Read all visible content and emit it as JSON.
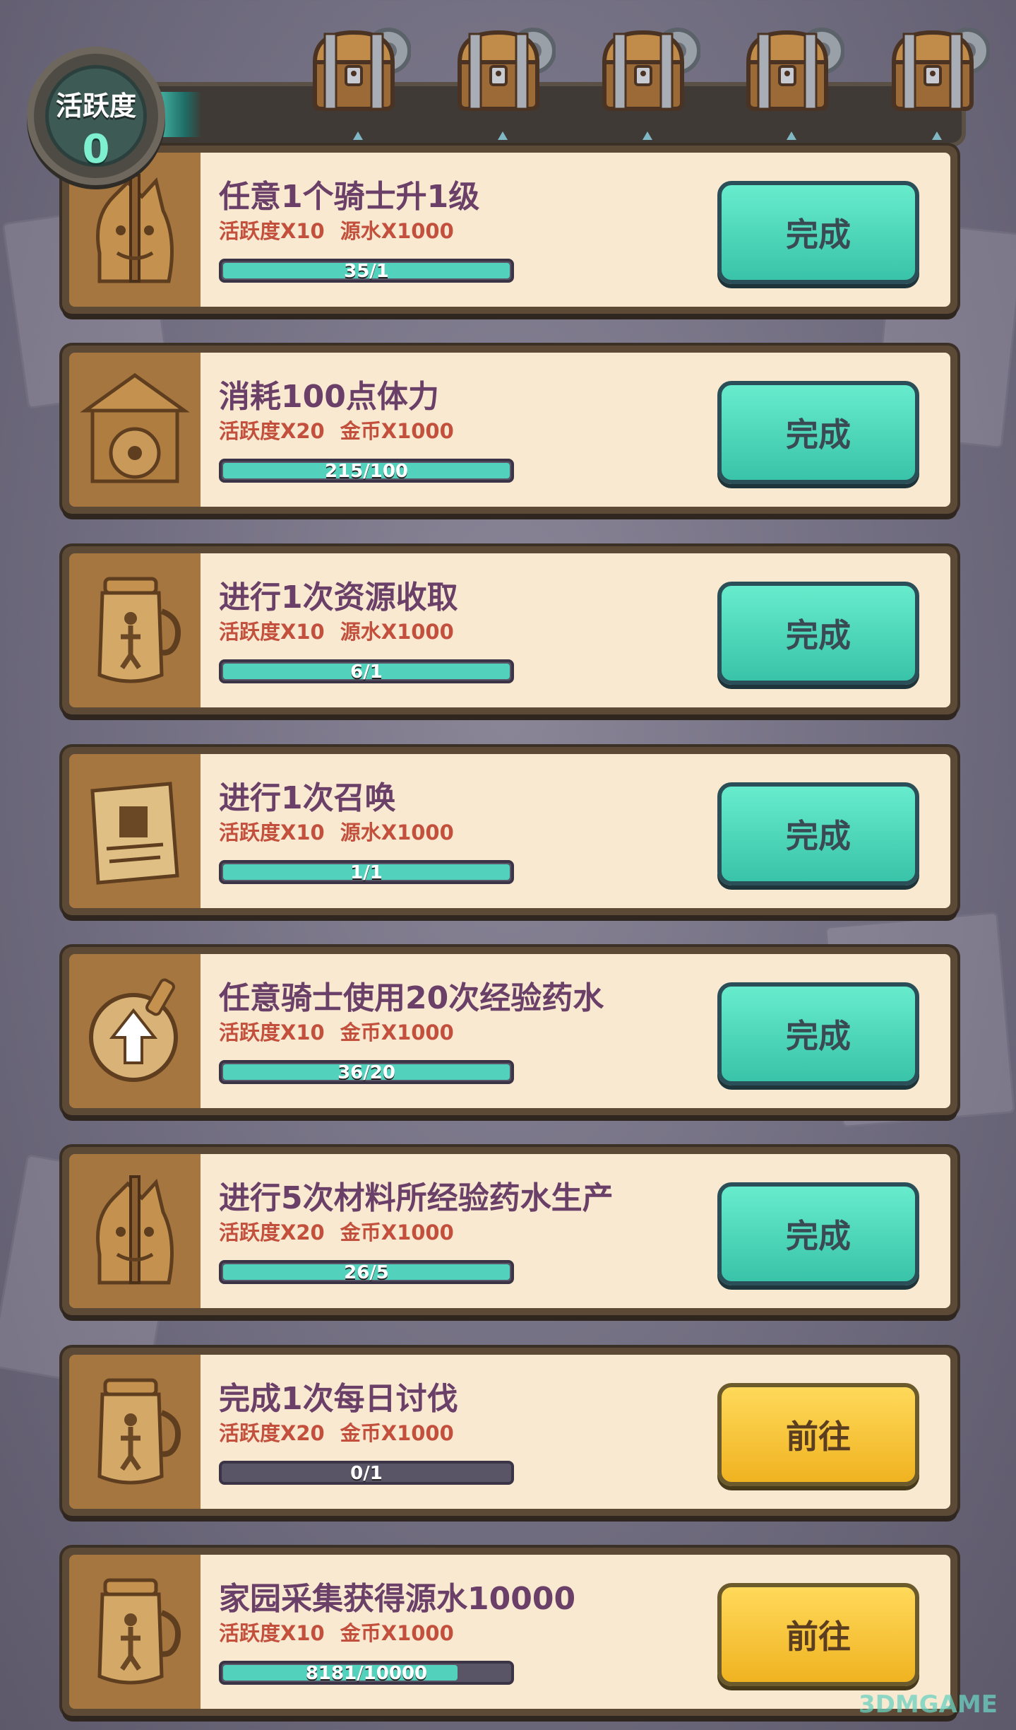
{
  "activity": {
    "label": "活跃度",
    "value": "0",
    "progress": 0
  },
  "chests": [
    "chest-1",
    "chest-2",
    "chest-3",
    "chest-4",
    "chest-5"
  ],
  "colors": {
    "done": "#39c3a8",
    "go": "#f0b321",
    "title": "#6a3f68",
    "reward": "#c34f3d"
  },
  "tasks": [
    {
      "title": "任意1个骑士升1级",
      "reward1": "活跃度X10",
      "reward2": "源水X1000",
      "progress": "35/1",
      "ratio": 1.0,
      "button": "完成",
      "state": "done",
      "icon": "knight-portrait-icon"
    },
    {
      "title": "消耗100点体力",
      "reward1": "活跃度X20",
      "reward2": "金币X1000",
      "progress": "215/100",
      "ratio": 1.0,
      "button": "完成",
      "state": "done",
      "icon": "gate-icon"
    },
    {
      "title": "进行1次资源收取",
      "reward1": "活跃度X10",
      "reward2": "源水X1000",
      "progress": "6/1",
      "ratio": 1.0,
      "button": "完成",
      "state": "done",
      "icon": "jar-icon"
    },
    {
      "title": "进行1次召唤",
      "reward1": "活跃度X10",
      "reward2": "源水X1000",
      "progress": "1/1",
      "ratio": 1.0,
      "button": "完成",
      "state": "done",
      "icon": "scroll-icon"
    },
    {
      "title": "任意骑士使用20次经验药水",
      "reward1": "活跃度X10",
      "reward2": "金币X1000",
      "progress": "36/20",
      "ratio": 1.0,
      "button": "完成",
      "state": "done",
      "icon": "potion-icon"
    },
    {
      "title": "进行5次材料所经验药水生产",
      "reward1": "活跃度X20",
      "reward2": "金币X1000",
      "progress": "26/5",
      "ratio": 1.0,
      "button": "完成",
      "state": "done",
      "icon": "knight-portrait-icon"
    },
    {
      "title": "完成1次每日讨伐",
      "reward1": "活跃度X20",
      "reward2": "金币X1000",
      "progress": "0/1",
      "ratio": 0.0,
      "button": "前往",
      "state": "go",
      "icon": "jar-icon"
    },
    {
      "title": "家园采集获得源水10000",
      "reward1": "活跃度X10",
      "reward2": "金币X1000",
      "progress": "8181/10000",
      "ratio": 0.8181,
      "button": "前往",
      "state": "go",
      "icon": "jar-icon"
    }
  ],
  "watermark": "3DMGAME"
}
